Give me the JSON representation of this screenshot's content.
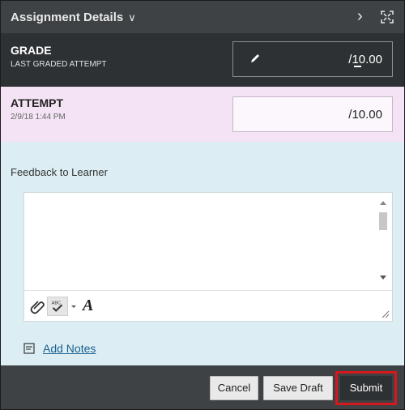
{
  "header": {
    "title": "Assignment Details",
    "chevron_icon": "chevron-down-icon",
    "next_icon": "chevron-right-icon",
    "expand_icon": "expand-icon"
  },
  "grade": {
    "label": "GRADE",
    "sublabel": "LAST GRADED ATTEMPT",
    "value": "/10.00",
    "edit_icon": "pencil-icon"
  },
  "attempt": {
    "label": "ATTEMPT",
    "date": "2/9/18 1:44 PM",
    "value": "/10.00"
  },
  "feedback": {
    "label": "Feedback to Learner",
    "text": "",
    "toolbar": {
      "attach_icon": "paperclip-icon",
      "spellcheck_icon": "spellcheck-icon",
      "font_icon": "font-icon",
      "font_glyph": "A"
    }
  },
  "notes": {
    "label": "Add Notes",
    "icon": "notes-icon"
  },
  "footer": {
    "cancel": "Cancel",
    "save_draft": "Save Draft",
    "submit": "Submit"
  },
  "colors": {
    "header_bg": "#3e4244",
    "grade_bg": "#2e3133",
    "attempt_bg": "#f3e3f4",
    "feedback_bg": "#dceef3",
    "highlight": "#d4181c"
  }
}
